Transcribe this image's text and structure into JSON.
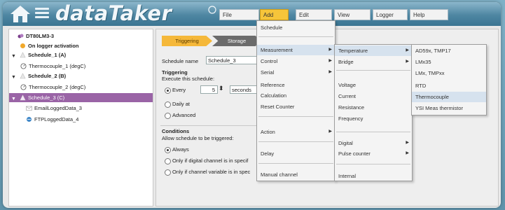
{
  "brand": {
    "name": "dataTaker"
  },
  "menubar": [
    {
      "label": "File"
    },
    {
      "label": "Add"
    },
    {
      "label": "Edit"
    },
    {
      "label": "View"
    },
    {
      "label": "Logger"
    },
    {
      "label": "Help"
    }
  ],
  "tree": [
    {
      "label": "DT80LM3-3"
    },
    {
      "label": "On logger activation"
    },
    {
      "label": "Schedule_1 (A)"
    },
    {
      "label": "Thermocouple_1 (degC)"
    },
    {
      "label": "Schedule_2 (B)"
    },
    {
      "label": "Thermocouple_2 (degC)"
    },
    {
      "label": "Schedule_3 (C)"
    },
    {
      "label": "EmailLoggedData_3"
    },
    {
      "label": "FTPLoggedData_4"
    }
  ],
  "tabs": {
    "triggering": "Triggering",
    "storage": "Storage"
  },
  "form": {
    "schedule_name_label": "Schedule name",
    "schedule_name_value": "Schedule_3",
    "triggering_heading": "Triggering",
    "execute_label": "Execute this schedule:",
    "every_label": "Every",
    "every_value": "5",
    "unit_value": "seconds",
    "daily_label": "Daily at",
    "advanced_label": "Advanced",
    "conditions_heading": "Conditions",
    "allow_label": "Allow schedule to be triggered:",
    "always_label": "Always",
    "digital_label": "Only if digital channel is in specif",
    "variable_label": "Only if channel variable is in spec"
  },
  "add_menu": {
    "items": [
      {
        "label": "Schedule"
      },
      {
        "label": "Measurement"
      },
      {
        "label": "Control"
      },
      {
        "label": "Serial"
      },
      {
        "label": "Reference"
      },
      {
        "label": "Calculation"
      },
      {
        "label": "Reset Counter"
      },
      {
        "label": "Action"
      },
      {
        "label": "Delay"
      },
      {
        "label": "Manual channel"
      }
    ]
  },
  "measurement_menu": {
    "items": [
      {
        "label": "Temperature"
      },
      {
        "label": "Bridge"
      },
      {
        "label": "Voltage"
      },
      {
        "label": "Current"
      },
      {
        "label": "Resistance"
      },
      {
        "label": "Frequency"
      },
      {
        "label": "Digital"
      },
      {
        "label": "Pulse counter"
      },
      {
        "label": "Internal"
      }
    ]
  },
  "temperature_menu": {
    "items": [
      {
        "label": "AD59x, TMP17"
      },
      {
        "label": "LMx35"
      },
      {
        "label": "LMx, TMPxx"
      },
      {
        "label": "RTD"
      },
      {
        "label": "Thermocouple"
      },
      {
        "label": "YSI Meas thermistor"
      }
    ]
  },
  "colors": {
    "accent": "#f6c53a",
    "selection": "#9a64a6",
    "titlebar": "#4e86a2"
  }
}
